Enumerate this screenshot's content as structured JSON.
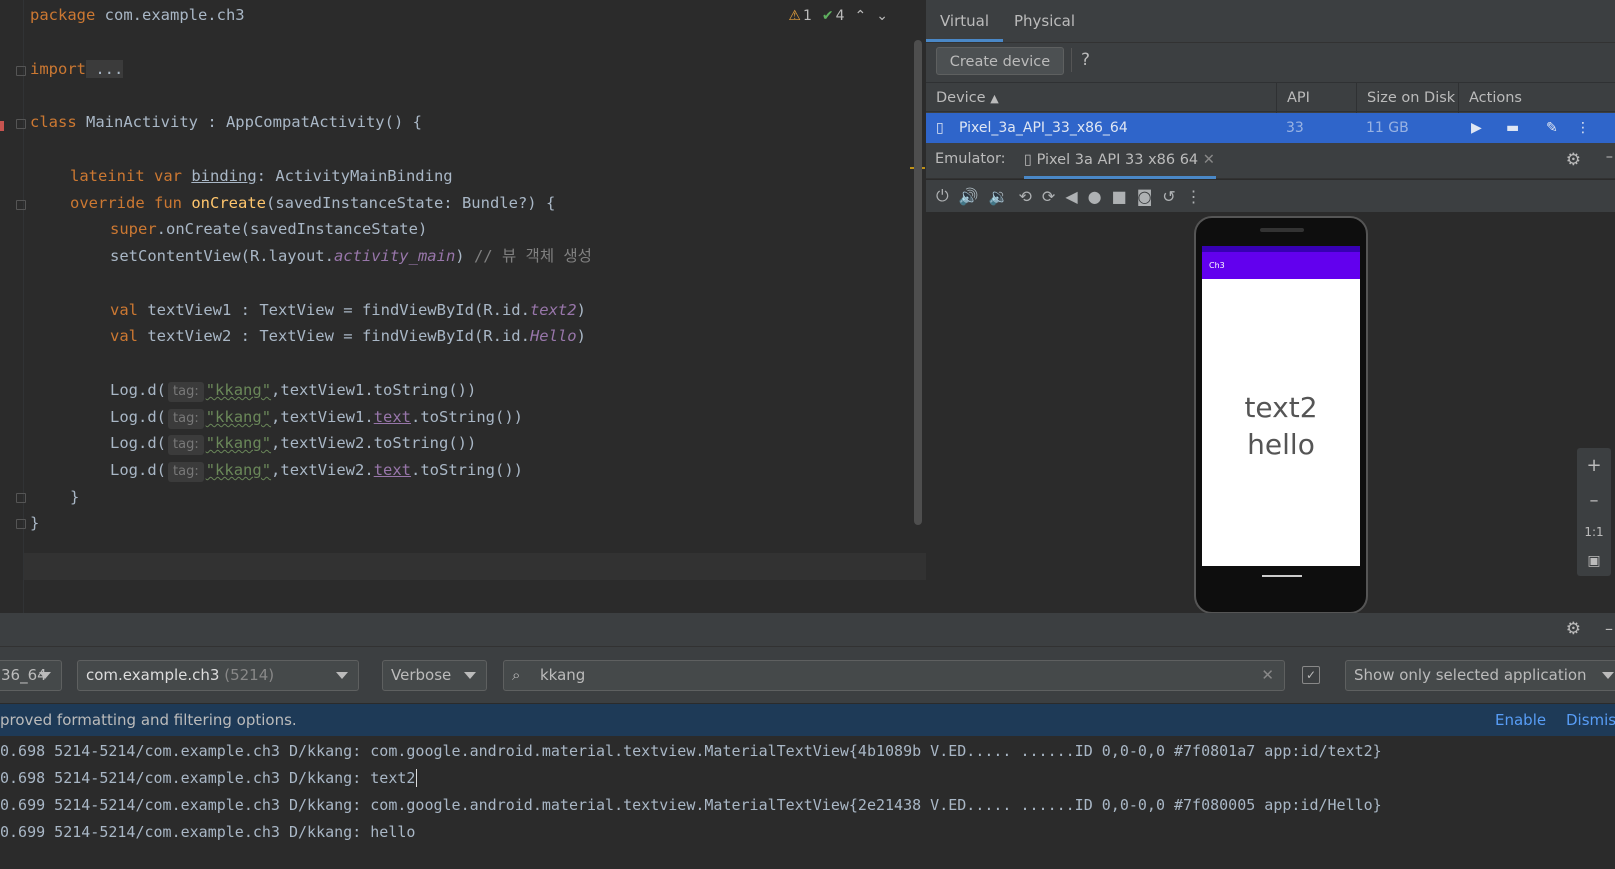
{
  "editor": {
    "code": [
      {
        "kw": "package",
        "rest": " com.example.ch3"
      },
      {
        "kw": "import",
        "rest": " ..."
      },
      {
        "kw": "class",
        "rest": " MainActivity : AppCompatActivity() {"
      },
      {
        "kw": "lateinit var",
        "u": "binding",
        "rest": ": ActivityMainBinding"
      },
      {
        "kw": "override fun",
        "fn": "onCreate",
        "rest": "(savedInstanceState: Bundle?) {"
      },
      {
        "kw": "super",
        "rest": ".onCreate(savedInstanceState)"
      },
      {
        "a": "setContentView(R.layout.",
        "i": "activity_main",
        "b": ") ",
        "c": "// 뷰 객체 생성"
      },
      {
        "kw": "val",
        "a": " textView1 : TextView = findViewById(R.id.",
        "i": "text2",
        "b": ")"
      },
      {
        "kw": "val",
        "a": " textView2 : TextView = findViewById(R.id.",
        "i": "Hello",
        "b": ")"
      },
      {
        "a": "Log.d(",
        "hint": "tag:",
        "s": "\"kkang\"",
        "b": ",textView1.toString())"
      },
      {
        "a": "Log.d(",
        "hint": "tag:",
        "s": "\"kkang\"",
        "m": ",textView1.",
        "p": "text",
        "b": ".toString())"
      },
      {
        "a": "Log.d(",
        "hint": "tag:",
        "s": "\"kkang\"",
        "b": ",textView2.toString())"
      },
      {
        "a": "Log.d(",
        "hint": "tag:",
        "s": "\"kkang\"",
        "m": ",textView2.",
        "p": "text",
        "b": ".toString())"
      },
      {
        "a": "}"
      },
      {
        "a": "}"
      }
    ],
    "warnings": "1",
    "checks": "4"
  },
  "device_manager": {
    "tabs": [
      "Virtual",
      "Physical"
    ],
    "create_label": "Create device",
    "help": "?",
    "columns": [
      "Device",
      "API",
      "Size on Disk",
      "Actions"
    ],
    "device_name": "Pixel_3a_API_33_x86_64",
    "device_api": "33",
    "device_size": "11 GB"
  },
  "emulator": {
    "label": "Emulator:",
    "tab_name": "Pixel 3a API 33 x86 64",
    "app_title": "Ch3",
    "text_one": "text2",
    "text_two": "hello",
    "zoom_ratio": "1:1"
  },
  "logcat": {
    "device_fragment": "36_64",
    "process_bold": "com.example.ch3",
    "process_pid": "(5214)",
    "level": "Verbose",
    "search": "kkang",
    "only_selected": "Show only selected application",
    "notice": "proved formatting and filtering options.",
    "enable": "Enable",
    "dismiss": "Dismiss",
    "lines": [
      "0.698 5214-5214/com.example.ch3 D/kkang: com.google.android.material.textview.MaterialTextView{4b1089b V.ED..... ......ID 0,0-0,0 #7f0801a7 app:id/text2}",
      "0.698 5214-5214/com.example.ch3 D/kkang: text2",
      "0.699 5214-5214/com.example.ch3 D/kkang: com.google.android.material.textview.MaterialTextView{2e21438 V.ED..... ......ID 0,0-0,0 #7f080005 app:id/Hello}",
      "0.699 5214-5214/com.example.ch3 D/kkang: hello"
    ]
  }
}
